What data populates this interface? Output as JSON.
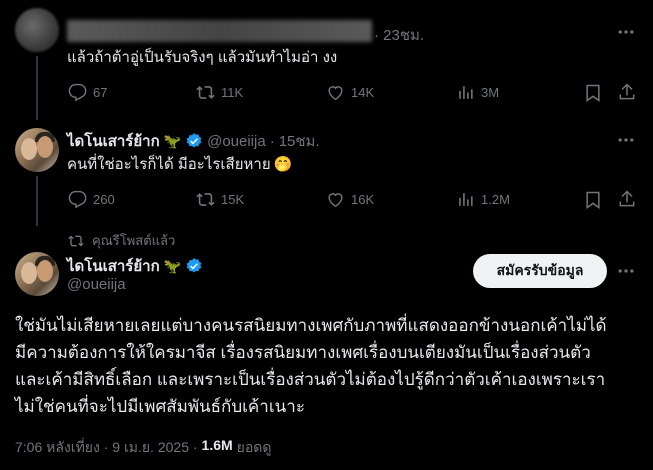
{
  "tweet1": {
    "time": "23ชม.",
    "text": "แล้วถ้าต้าอู่เป็นรับจริงๆ แล้วมันทำไมอ่า งง",
    "replies": "67",
    "reposts": "11K",
    "likes": "14K",
    "views": "3M"
  },
  "tweet2": {
    "name": "ไดโนเสาร์ย้าก",
    "handle": "@oueiija",
    "time": "15ชม.",
    "text": "คนที่ใช่อะไรก็ได้ มีอะไรเสียหาย",
    "emoji": "🤭",
    "replies": "260",
    "reposts": "15K",
    "likes": "16K",
    "views": "1.2M"
  },
  "repost_note": "คุณรีโพสต์แล้ว",
  "main": {
    "name": "ไดโนเสาร์ย้าก",
    "handle": "@oueiija",
    "subscribe_label": "สมัครรับข้อมูล",
    "lines": [
      "ใช่มันไม่เสียหายเลยแต่บางคนรสนิยมทางเพศกับภาพที่แสดงออกข้างนอกเค้าไม่ได้",
      "มีความต้องการให้ใครมาจีส เรื่องรสนิยมทางเพศเรื่องบนเตียงมันเป็นเรื่องส่วนตัว",
      "และเค้ามีสิทธิ์เลือก และเพราะเป็นเรื่องส่วนตัวไม่ต้องไปรู้ดีกว่าตัวเค้าเองเพราะเรา",
      "ไม่ใช่คนที่จะไปมีเพศสัมพันธ์กับเค้าเนาะ"
    ],
    "timestamp": "7:06 หลังเที่ยง · 9 เม.ย. 2025 ·",
    "views_count": "1.6M",
    "views_label": "ยอดดู"
  },
  "dino_emoji": "🦖",
  "colors": {
    "accent": "#1d9bf0",
    "background": "#000000",
    "muted": "#71767b"
  }
}
